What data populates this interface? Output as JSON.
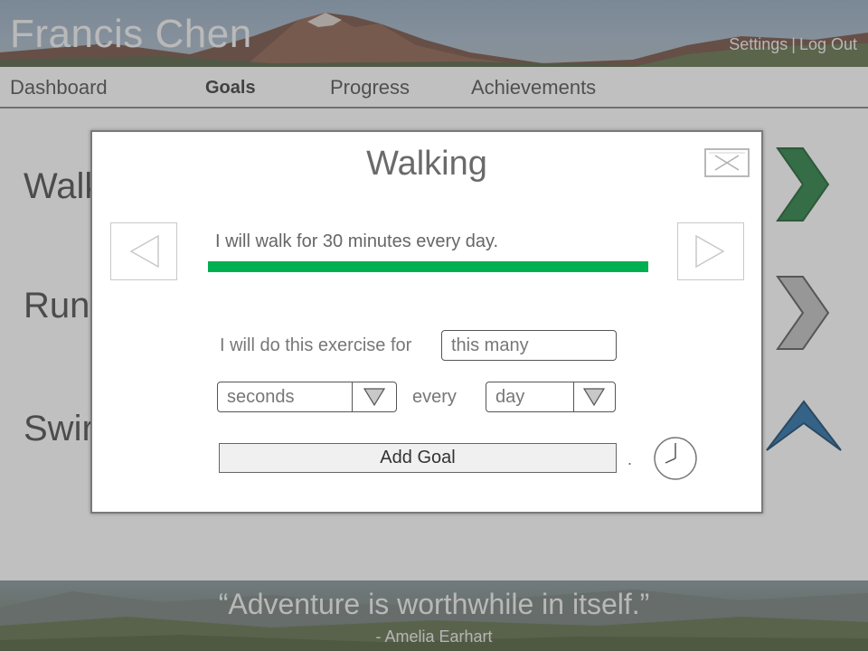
{
  "header": {
    "user_name": "Francis Chen",
    "links": {
      "settings": "Settings",
      "separator": "|",
      "logout": "Log Out"
    }
  },
  "nav": {
    "items": [
      {
        "label": "Dashboard",
        "active": false
      },
      {
        "label": "Goals",
        "active": true
      },
      {
        "label": "Progress",
        "active": false
      },
      {
        "label": "Achievements",
        "active": false
      }
    ]
  },
  "background_page": {
    "exercises": [
      {
        "label": "Walk",
        "chevron_color": "#1e7a3a",
        "chevron_icon": "chevron-right-icon"
      },
      {
        "label": "Runn",
        "chevron_color": "#8c8c8c",
        "chevron_icon": "chevron-right-icon"
      },
      {
        "label": "Swir",
        "chevron_color": "#1f6aa5",
        "chevron_icon": "chevron-up-icon"
      }
    ]
  },
  "footer": {
    "quote": "“Adventure is worthwhile in itself.”",
    "author": "- Amelia Earhart"
  },
  "modal": {
    "title": "Walking",
    "close_icon": "close-icon",
    "prev_icon": "triangle-left-icon",
    "next_icon": "triangle-right-icon",
    "goal_statement": "I will walk for 30 minutes every day.",
    "goal_progress_percent": 100,
    "goal_bar_color": "#00b050",
    "form": {
      "prefix_label": "I will do this exercise for",
      "amount_placeholder": "this many",
      "unit_select": {
        "value": "seconds"
      },
      "every_label": "every",
      "period_select": {
        "value": "day"
      },
      "add_button_label": "Add Goal",
      "trailing_mark": ".",
      "clock_icon": "clock-icon"
    }
  }
}
